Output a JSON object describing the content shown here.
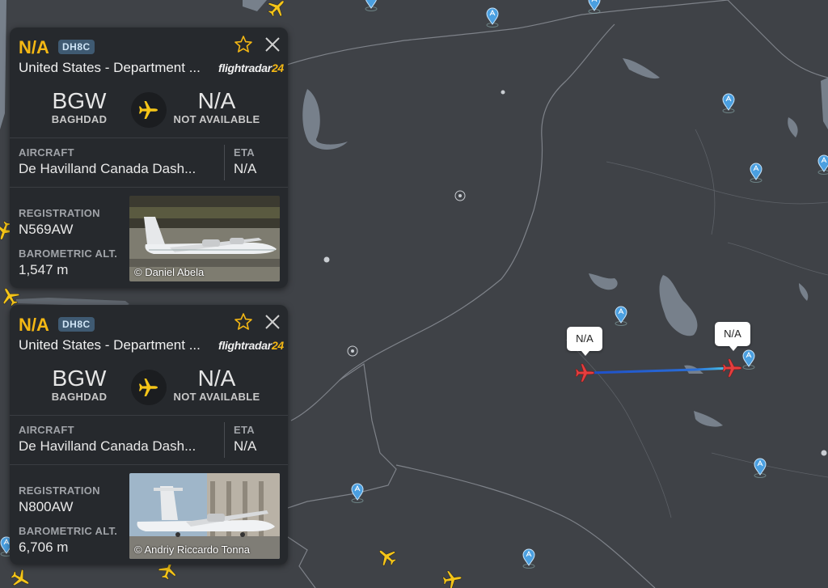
{
  "map": {
    "label_a": "N/A",
    "label_b": "N/A",
    "colors": {
      "background": "#3f4247",
      "water": "#77808b",
      "border": "#7e8289",
      "track_start": "#1e4ec8",
      "track_end": "#4fd4ec",
      "selected_aircraft": "#e53e3e",
      "aircraft": "#f5c518",
      "poi": "#4a9fe0"
    }
  },
  "cards": [
    {
      "callsign": "N/A",
      "aircraft_type": "DH8C",
      "operator": "United States - Department ...",
      "logo_text": "flightradar",
      "logo_num": "24",
      "origin": {
        "code": "BGW",
        "city": "BAGHDAD"
      },
      "destination": {
        "code": "N/A",
        "city": "NOT AVAILABLE"
      },
      "aircraft_label": "AIRCRAFT",
      "aircraft_value": "De Havilland Canada Dash...",
      "eta_label": "ETA",
      "eta_value": "N/A",
      "registration_label": "REGISTRATION",
      "registration_value": "N569AW",
      "altitude_label": "BAROMETRIC ALT.",
      "altitude_value": "1,547 m",
      "photo_credit": "© Daniel Abela"
    },
    {
      "callsign": "N/A",
      "aircraft_type": "DH8C",
      "operator": "United States - Department ...",
      "logo_text": "flightradar",
      "logo_num": "24",
      "origin": {
        "code": "BGW",
        "city": "BAGHDAD"
      },
      "destination": {
        "code": "N/A",
        "city": "NOT AVAILABLE"
      },
      "aircraft_label": "AIRCRAFT",
      "aircraft_value": "De Havilland Canada Dash...",
      "eta_label": "ETA",
      "eta_value": "N/A",
      "registration_label": "REGISTRATION",
      "registration_value": "N800AW",
      "altitude_label": "BAROMETRIC ALT.",
      "altitude_value": "6,706 m",
      "photo_credit": "© Andriy Riccardo Tonna"
    }
  ],
  "icons": [
    "star-icon",
    "close-icon",
    "airplane-icon",
    "airport-pin-icon",
    "vor-beacon-icon"
  ]
}
